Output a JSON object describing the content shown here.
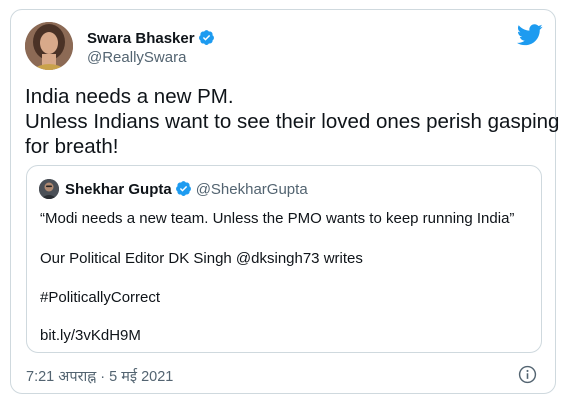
{
  "author": {
    "name": "Swara Bhasker",
    "handle": "@ReallySwara"
  },
  "tweet": {
    "lines": [
      "India needs a new PM.",
      "Unless Indians want to see their loved ones perish gasping",
      "for breath!"
    ]
  },
  "quoted": {
    "name": "Shekhar Gupta",
    "handle": "@ShekharGupta",
    "lines": [
      "“Modi needs a new team. Unless the PMO wants to keep running India”",
      "Our Political Editor DK Singh @dksingh73 writes",
      "#PoliticallyCorrect",
      "bit.ly/3vKdH9M"
    ]
  },
  "timestamp": "7:21 अपराह्न · 5 मई 2021",
  "icons": {
    "verified": "verified-badge-icon",
    "brand": "twitter-bird-icon",
    "info": "info-icon"
  },
  "colors": {
    "brand_blue": "#1d9bf0",
    "text": "#0f1419",
    "secondary_text": "#536471",
    "border": "#cfd9de"
  }
}
